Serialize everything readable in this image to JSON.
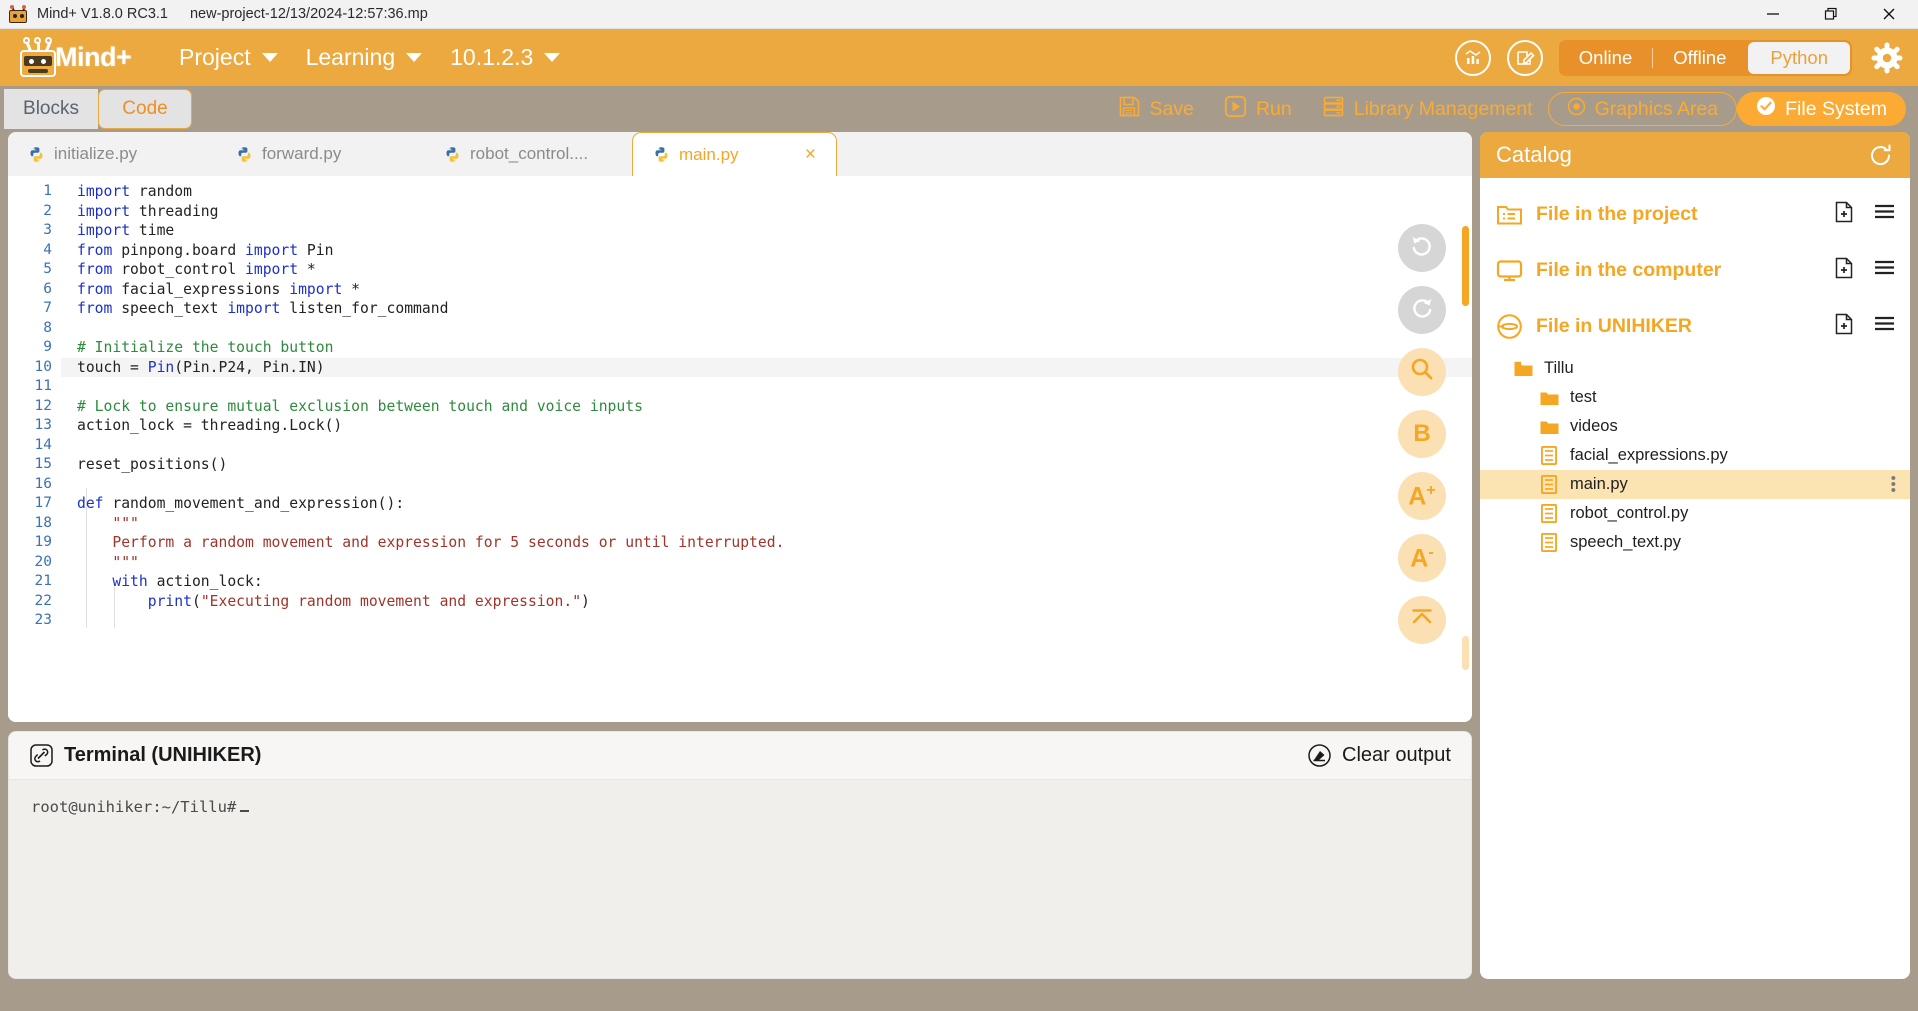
{
  "window": {
    "app_title": "Mind+ V1.8.0 RC3.1",
    "file_name": "new-project-12/13/2024-12:57:36.mp",
    "minimize": "minimize-button",
    "maximize": "restore-button",
    "close": "close-button"
  },
  "header": {
    "brand": "Mind",
    "brand_plus": "+",
    "menus": [
      {
        "label": "Project"
      },
      {
        "label": "Learning"
      },
      {
        "label": "10.1.2.3"
      }
    ],
    "icons": [
      {
        "name": "data-chart-icon"
      },
      {
        "name": "edit-note-icon"
      }
    ],
    "online_label": "Online",
    "offline_label": "Offline",
    "language_label": "Python",
    "settings_label": "gear-icon",
    "accent": "#eba940"
  },
  "toolbar": {
    "blocks_label": "Blocks",
    "code_label": "Code",
    "save_label": "Save",
    "run_label": "Run",
    "library_label": "Library Management",
    "graphics_label": "Graphics Area",
    "filesystem_label": "File System"
  },
  "tabs": [
    {
      "label": "initialize.py",
      "active": false
    },
    {
      "label": "forward.py",
      "active": false
    },
    {
      "label": "robot_control....",
      "active": false
    },
    {
      "label": "main.py",
      "active": true,
      "close": "×"
    }
  ],
  "editor": {
    "lines": [
      {
        "n": 1,
        "html": "<span class='kw'>import</span> random"
      },
      {
        "n": 2,
        "html": "<span class='kw'>import</span> threading"
      },
      {
        "n": 3,
        "html": "<span class='kw'>import</span> time"
      },
      {
        "n": 4,
        "html": "<span class='kw'>from</span> pinpong.board <span class='kw'>import</span> Pin"
      },
      {
        "n": 5,
        "html": "<span class='kw'>from</span> robot_control <span class='kw'>import</span> *"
      },
      {
        "n": 6,
        "html": "<span class='kw'>from</span> facial_expressions <span class='kw'>import</span> *"
      },
      {
        "n": 7,
        "html": "<span class='kw'>from</span> speech_text <span class='kw'>import</span> listen_for_command"
      },
      {
        "n": 8,
        "html": ""
      },
      {
        "n": 9,
        "html": "<span class='cm'># Initialize the touch button</span>"
      },
      {
        "n": 10,
        "html": "touch = <span class='fn'>Pin</span>(Pin.P24, Pin.IN)",
        "highlight": true
      },
      {
        "n": 11,
        "html": ""
      },
      {
        "n": 12,
        "html": "<span class='cm'># Lock to ensure mutual exclusion between touch and voice inputs</span>"
      },
      {
        "n": 13,
        "html": "action_lock = threading.Lock()"
      },
      {
        "n": 14,
        "html": ""
      },
      {
        "n": 15,
        "html": "reset_positions()"
      },
      {
        "n": 16,
        "html": ""
      },
      {
        "n": 17,
        "html": "<span class='kw'>def</span> random_movement_and_expression():"
      },
      {
        "n": 18,
        "html": "    <span class='st'>\"\"\"</span>"
      },
      {
        "n": 19,
        "html": "    <span class='st'>Perform a random movement and expression for 5 seconds or until interrupted.</span>"
      },
      {
        "n": 20,
        "html": "    <span class='st'>\"\"\"</span>"
      },
      {
        "n": 21,
        "html": "    <span class='kw'>with</span> action_lock:"
      },
      {
        "n": 22,
        "html": "        <span class='fn'>print</span>(<span class='st'>\"Executing random movement and expression.\"</span>)"
      },
      {
        "n": 23,
        "html": ""
      }
    ],
    "fabs": [
      {
        "name": "undo-button",
        "glyph": "undo",
        "gray": true
      },
      {
        "name": "redo-button",
        "glyph": "redo",
        "gray": true
      },
      {
        "name": "search-button",
        "glyph": "search",
        "gray": false
      },
      {
        "name": "bold-button",
        "glyph": "B",
        "gray": false
      },
      {
        "name": "font-increase-button",
        "glyph": "A+",
        "gray": false
      },
      {
        "name": "font-decrease-button",
        "glyph": "A-",
        "gray": false
      },
      {
        "name": "collapse-button",
        "glyph": "chevron-up",
        "gray": false
      }
    ]
  },
  "terminal": {
    "title": "Terminal (UNIHIKER)",
    "clear_label": "Clear output",
    "prompt": "root@unihiker:~/Tillu#"
  },
  "catalog": {
    "title": "Catalog",
    "refresh": "refresh-icon",
    "groups": [
      {
        "label": "File in the project",
        "icon": "folder-list-icon"
      },
      {
        "label": "File in the computer",
        "icon": "monitor-icon"
      },
      {
        "label": "File in UNIHIKER",
        "icon": "unihiker-icon"
      }
    ],
    "tree": [
      {
        "label": "Tillu",
        "type": "folder",
        "indent": 1,
        "selected": false
      },
      {
        "label": "test",
        "type": "folder",
        "indent": 2,
        "selected": false
      },
      {
        "label": "videos",
        "type": "folder",
        "indent": 2,
        "selected": false
      },
      {
        "label": "facial_expressions.py",
        "type": "file",
        "indent": 2,
        "selected": false
      },
      {
        "label": "main.py",
        "type": "file",
        "indent": 2,
        "selected": true,
        "menu": "⋮"
      },
      {
        "label": "robot_control.py",
        "type": "file",
        "indent": 2,
        "selected": false
      },
      {
        "label": "speech_text.py",
        "type": "file",
        "indent": 2,
        "selected": false
      }
    ]
  }
}
